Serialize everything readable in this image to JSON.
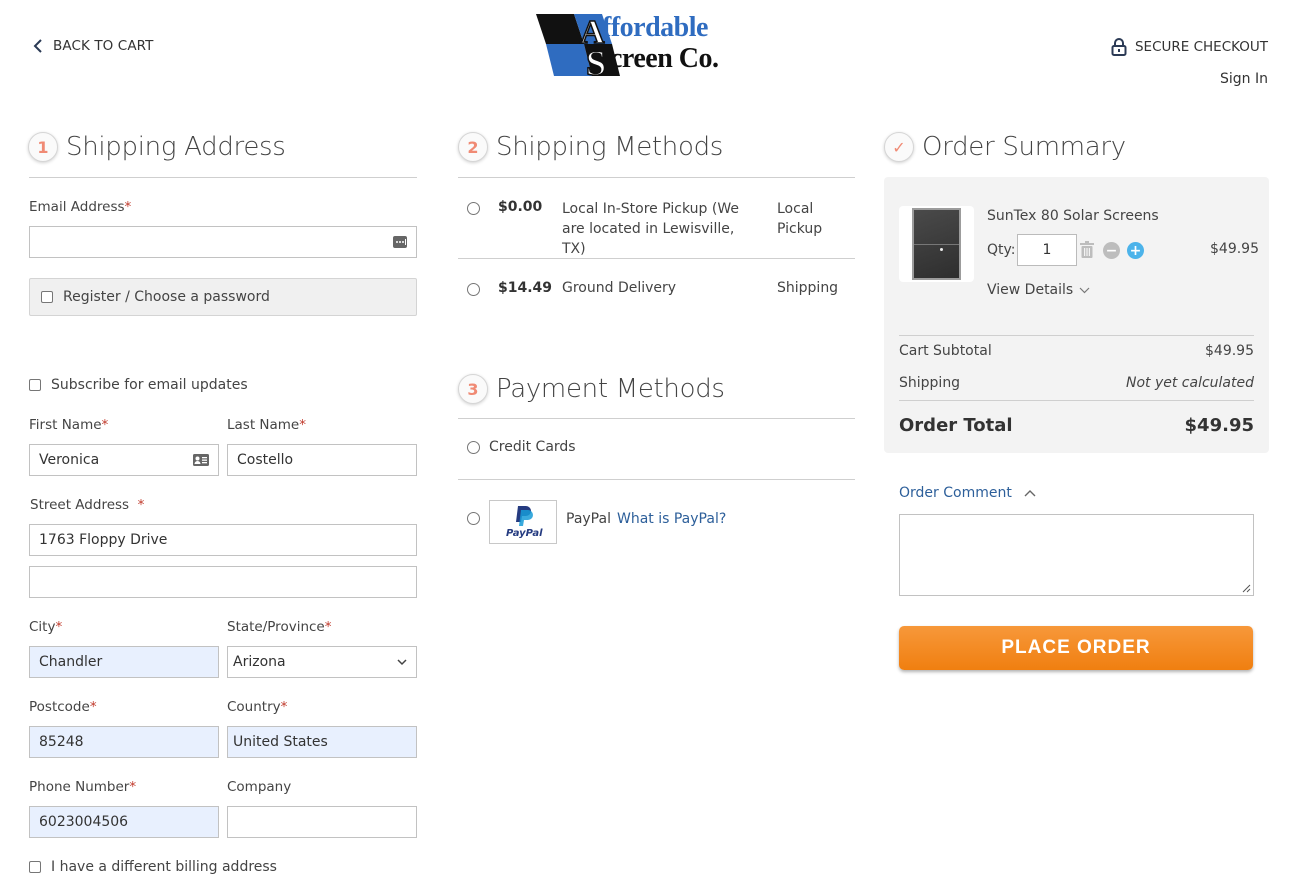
{
  "header": {
    "back_label": "BACK TO CART",
    "logo_line1": "Affordable",
    "logo_line2": "Screen Co.",
    "secure_label": "SECURE CHECKOUT",
    "signin_label": "Sign In"
  },
  "colors": {
    "accent_orange": "#f07f10",
    "badge_number": "#f08a74",
    "link_blue": "#2d5f9a",
    "autofill_bg": "#e8f0fe",
    "logo_blue": "#2f6cc0"
  },
  "shipping_address": {
    "step_number": "1",
    "title": "Shipping Address",
    "email": {
      "label": "Email Address",
      "value": ""
    },
    "register_label": "Register / Choose a password",
    "subscribe_label": "Subscribe for email updates",
    "first_name": {
      "label": "First Name",
      "value": "Veronica"
    },
    "last_name": {
      "label": "Last Name",
      "value": "Costello"
    },
    "street": {
      "label": "Street Address",
      "line1": "1763 Floppy Drive",
      "line2": ""
    },
    "city": {
      "label": "City",
      "value": "Chandler"
    },
    "state": {
      "label": "State/Province",
      "value": "Arizona"
    },
    "postcode": {
      "label": "Postcode",
      "value": "85248"
    },
    "country": {
      "label": "Country",
      "value": "United States"
    },
    "phone": {
      "label": "Phone Number",
      "value": "6023004506"
    },
    "company": {
      "label": "Company",
      "value": ""
    },
    "billing_label": "I have a different billing address",
    "required_mark": "*"
  },
  "shipping_methods": {
    "step_number": "2",
    "title": "Shipping Methods",
    "options": [
      {
        "price": "$0.00",
        "method": "Local In-Store Pickup (We are located in Lewisville, TX)",
        "carrier": "Local Pickup"
      },
      {
        "price": "$14.49",
        "method": "Ground Delivery",
        "carrier": "Shipping"
      }
    ]
  },
  "payment_methods": {
    "step_number": "3",
    "title": "Payment Methods",
    "options": [
      {
        "label": "Credit Cards"
      },
      {
        "label": "PayPal",
        "link": "What is PayPal?",
        "logo_text": "PayPal"
      }
    ]
  },
  "order_summary": {
    "step_mark": "✓",
    "title": "Order Summary",
    "item": {
      "name": "SunTex 80 Solar Screens",
      "qty_label": "Qty:",
      "qty": "1",
      "price": "$49.95",
      "details_label": "View Details"
    },
    "subtotal_label": "Cart Subtotal",
    "subtotal_value": "$49.95",
    "shipping_label": "Shipping",
    "shipping_value": "Not yet calculated",
    "total_label": "Order Total",
    "total_value": "$49.95",
    "comment_label": "Order Comment",
    "comment_value": "",
    "place_order_label": "PLACE ORDER"
  }
}
